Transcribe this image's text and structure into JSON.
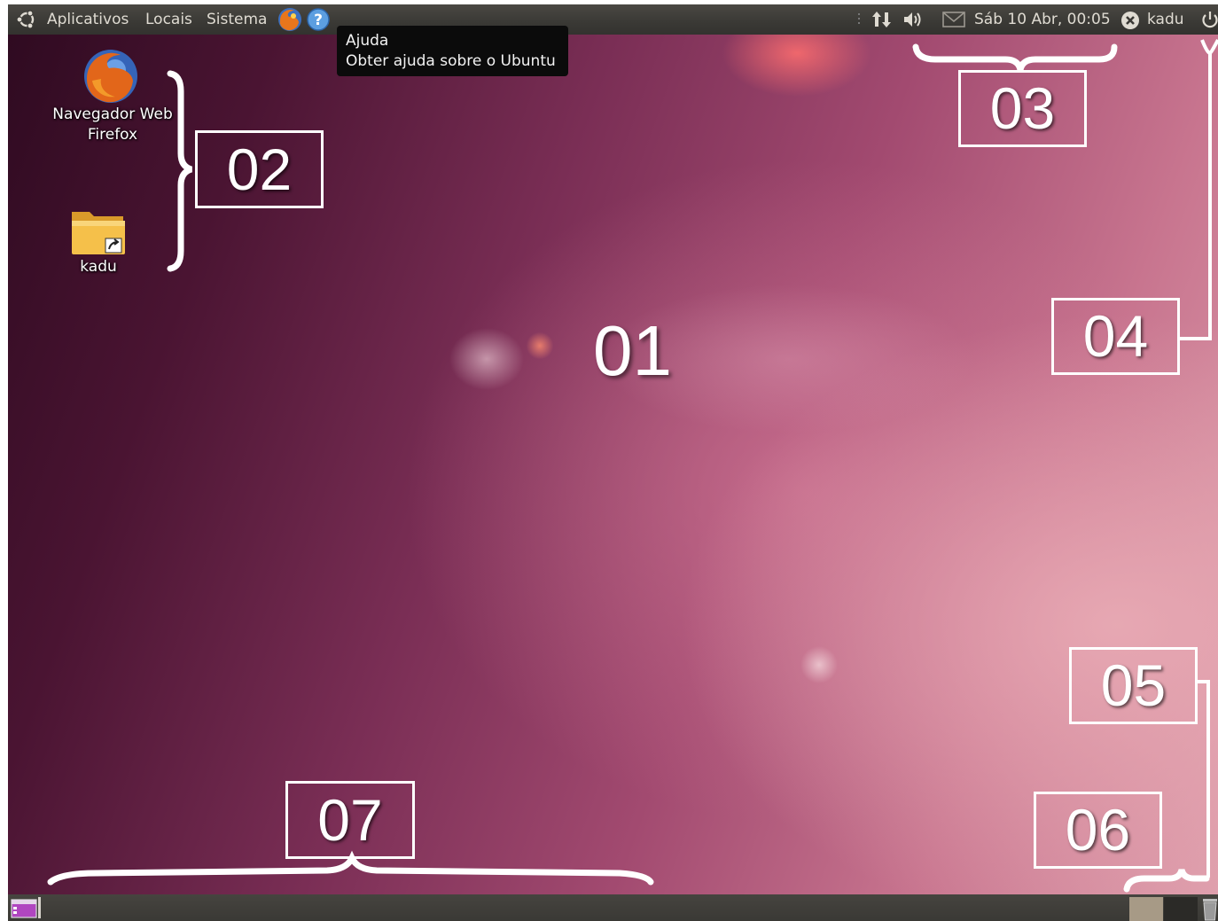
{
  "panel_top": {
    "menus": [
      "Aplicativos",
      "Locais",
      "Sistema"
    ],
    "launcher_icons": [
      "firefox-icon",
      "help-icon"
    ],
    "indicator_icons": [
      "network-icon",
      "volume-icon",
      "mail-icon"
    ],
    "clock": "Sáb 10 Abr, 00:05",
    "user": "kadu",
    "session_icon": "power-icon"
  },
  "tooltip": {
    "title": "Ajuda",
    "description": "Obter ajuda sobre o Ubuntu"
  },
  "desktop": {
    "icons": [
      {
        "label_line1": "Navegador Web",
        "label_line2": "Firefox",
        "icon": "firefox-icon"
      },
      {
        "label": "kadu",
        "icon": "home-folder-icon"
      }
    ]
  },
  "annotations": {
    "a01": "01",
    "a02": "02",
    "a03": "03",
    "a04": "04",
    "a05": "05",
    "a06": "06",
    "a07": "07"
  },
  "panel_bottom": {
    "show_desktop_icon": "show-desktop-icon",
    "workspace_icons": [
      "workspace-1",
      "workspace-2"
    ],
    "trash_icon": "trash-icon"
  },
  "colors": {
    "panel": "#3c3b37",
    "wallpaper_dark": "#2e0a20",
    "wallpaper_light": "#dfa0ad",
    "tooltip_bg": "#0b0b0b"
  }
}
